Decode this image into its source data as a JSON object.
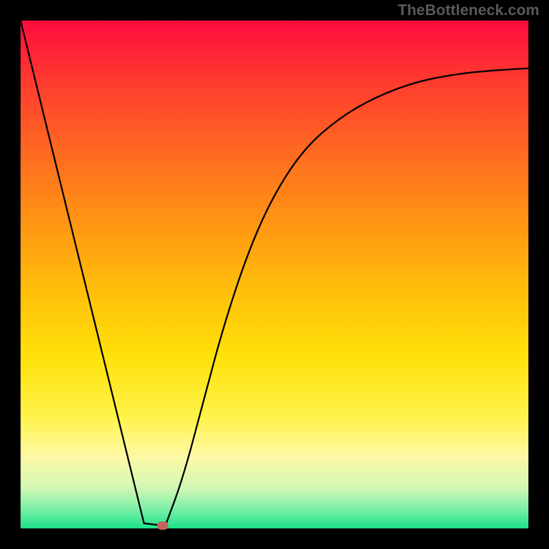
{
  "attribution": "TheBottleneck.com",
  "chart_data": {
    "type": "line",
    "title": "",
    "xlabel": "",
    "ylabel": "",
    "xlim": [
      0,
      100
    ],
    "ylim": [
      0,
      100
    ],
    "grid": false,
    "legend": false,
    "series": [
      {
        "name": "left-segment",
        "x": [
          0,
          24.3
        ],
        "y": [
          100,
          1
        ]
      },
      {
        "name": "valley-floor",
        "x": [
          24.3,
          28.5
        ],
        "y": [
          1,
          0.5
        ]
      },
      {
        "name": "right-curve",
        "x": [
          28.5,
          32,
          36,
          40,
          45,
          50,
          56,
          63,
          70,
          78,
          86,
          93,
          100
        ],
        "y": [
          0.5,
          10,
          25,
          40,
          55,
          66,
          75,
          81,
          85,
          88,
          89.5,
          90.2,
          90.6
        ]
      }
    ],
    "marker": {
      "x": 28,
      "y": 0.5,
      "color": "#c9645c"
    },
    "gradient_colors": [
      "#ff0a3d",
      "#ff9613",
      "#fff34a",
      "#1ee28a"
    ]
  }
}
